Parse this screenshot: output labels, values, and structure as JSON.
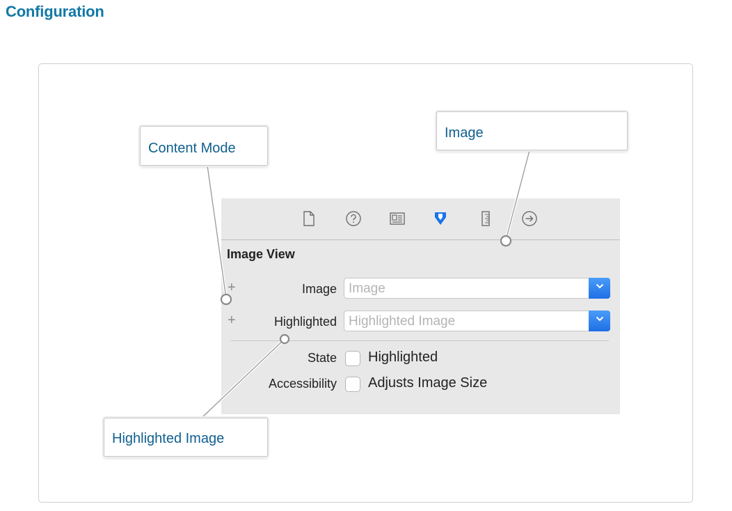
{
  "page": {
    "title": "Configuration"
  },
  "inspector": {
    "tabs": [
      {
        "icon": "file-inspector-icon",
        "selected": false
      },
      {
        "icon": "quick-help-icon",
        "selected": false
      },
      {
        "icon": "identity-inspector-icon",
        "selected": false
      },
      {
        "icon": "attributes-inspector-icon",
        "selected": true
      },
      {
        "icon": "size-inspector-icon",
        "selected": false
      },
      {
        "icon": "connections-inspector-icon",
        "selected": false
      }
    ],
    "section_title": "Image View",
    "image_row": {
      "label": "Image",
      "placeholder": "Image"
    },
    "highlighted_row": {
      "label": "Highlighted",
      "placeholder": "Highlighted Image"
    },
    "state_row": {
      "label": "State",
      "checkbox_label": "Highlighted",
      "checked": false
    },
    "accessibility_row": {
      "label": "Accessibility",
      "checkbox_label": "Adjusts Image Size",
      "checked": false
    },
    "plus_symbol": "+"
  },
  "callouts": {
    "content_mode": "Content Mode",
    "image": "Image",
    "highlighted_image": "Highlighted Image"
  },
  "colors": {
    "title": "#1279a6",
    "callout_text": "#0f5f8f",
    "selected_tab": "#1a73e8",
    "panel_bg": "#e8e8e8"
  }
}
